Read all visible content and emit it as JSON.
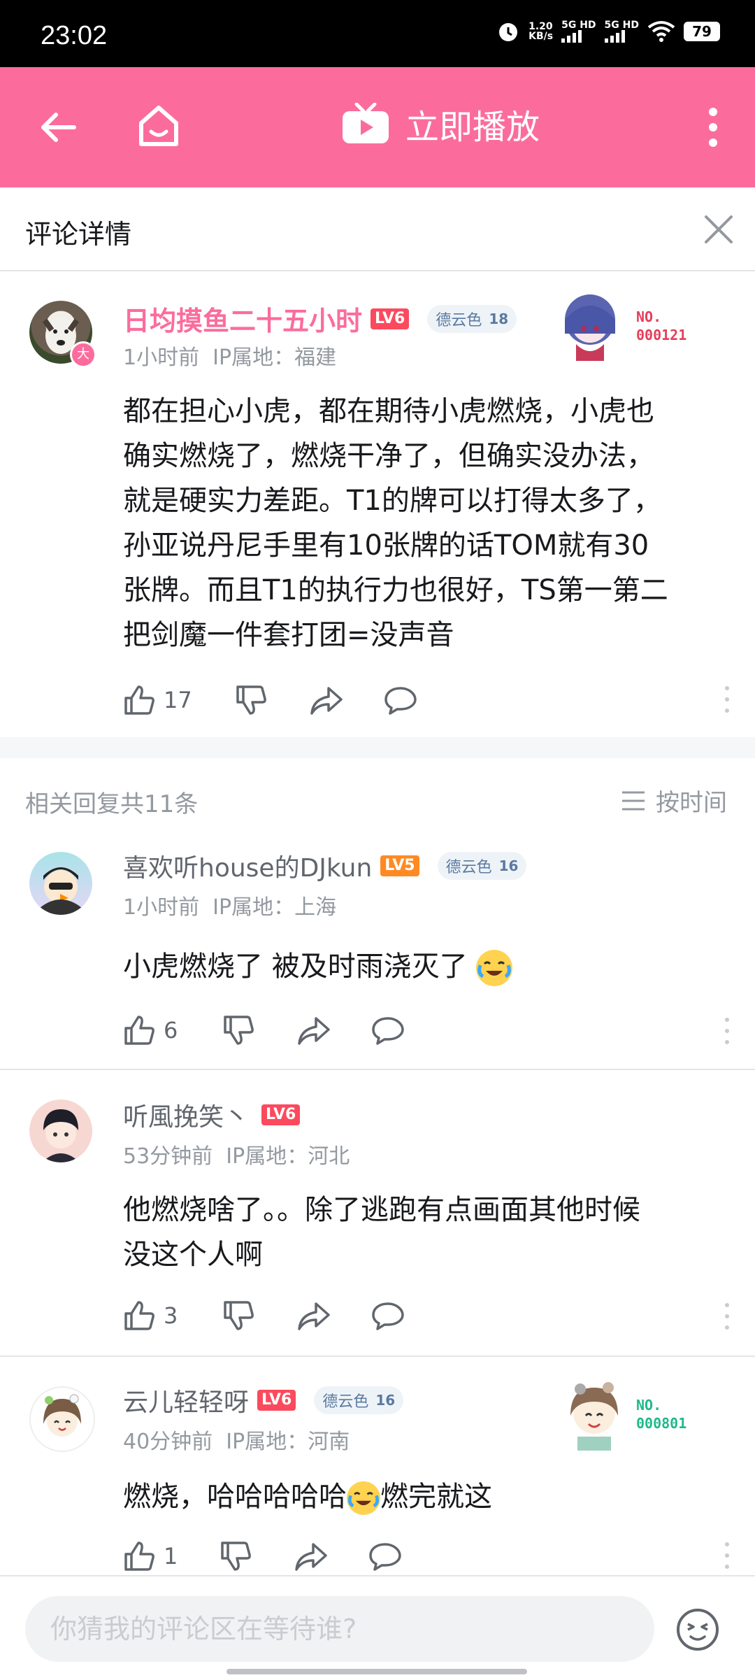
{
  "status": {
    "time": "23:02",
    "speed": "1.20",
    "speed_unit": "KB/s",
    "sim1": "5G HD",
    "sim2": "5G HD",
    "battery": "79"
  },
  "topbar": {
    "play_label": "立即播放"
  },
  "header": {
    "title": "评论详情"
  },
  "main_comment": {
    "username": "日均摸鱼二十五小时",
    "level": "LV6",
    "medal_name": "德云色",
    "medal_level": "18",
    "badge": "大",
    "no_label": "NO.",
    "no_value": "000121",
    "time": "1小时前",
    "ip": "IP属地：福建",
    "text_lines": [
      "都在担心小虎，都在期待小虎燃烧，小虎也",
      "确实燃烧了，燃烧干净了，但确实没办法，",
      "就是硬实力差距。T1的牌可以打得太多了，",
      "孙亚说丹尼手里有10张牌的话TOM就有30",
      "张牌。而且T1的执行力也很好，TS第一第二",
      "把剑魔一件套打团=没声音"
    ],
    "likes": "17",
    "colors": {
      "username": "#fb6c9d"
    }
  },
  "replies_header": {
    "count_label": "相关回复共11条",
    "sort_label": "按时间"
  },
  "replies": [
    {
      "username": "喜欢听house的DJkun",
      "level": "LV5",
      "medal_name": "德云色",
      "medal_level": "16",
      "time": "1小时前",
      "ip": "IP属地：上海",
      "text": "小虎燃烧了 被及时雨浇灭了",
      "likes": "6"
    },
    {
      "username": "听風挽笑丶",
      "level": "LV6",
      "time": "53分钟前",
      "ip": "IP属地：河北",
      "text_lines": [
        "他燃烧啥了。。除了逃跑有点画面其他时候",
        "没这个人啊"
      ],
      "likes": "3"
    },
    {
      "username": "云儿轻轻呀",
      "level": "LV6",
      "medal_name": "德云色",
      "medal_level": "16",
      "time": "40分钟前",
      "ip": "IP属地：河南",
      "text_before": "燃烧，哈哈哈哈哈",
      "text_after": "燃完就这",
      "likes": "1",
      "no_label": "NO.",
      "no_value": "000801"
    }
  ],
  "composer": {
    "placeholder": "你猜我的评论区在等待谁?"
  },
  "icons": [
    "back-icon",
    "home-icon",
    "tv-play-icon",
    "more-icon",
    "close-icon",
    "like-icon",
    "dislike-icon",
    "share-icon",
    "reply-icon",
    "sort-icon",
    "emoji-icon"
  ],
  "accent": "#fb6c9d"
}
